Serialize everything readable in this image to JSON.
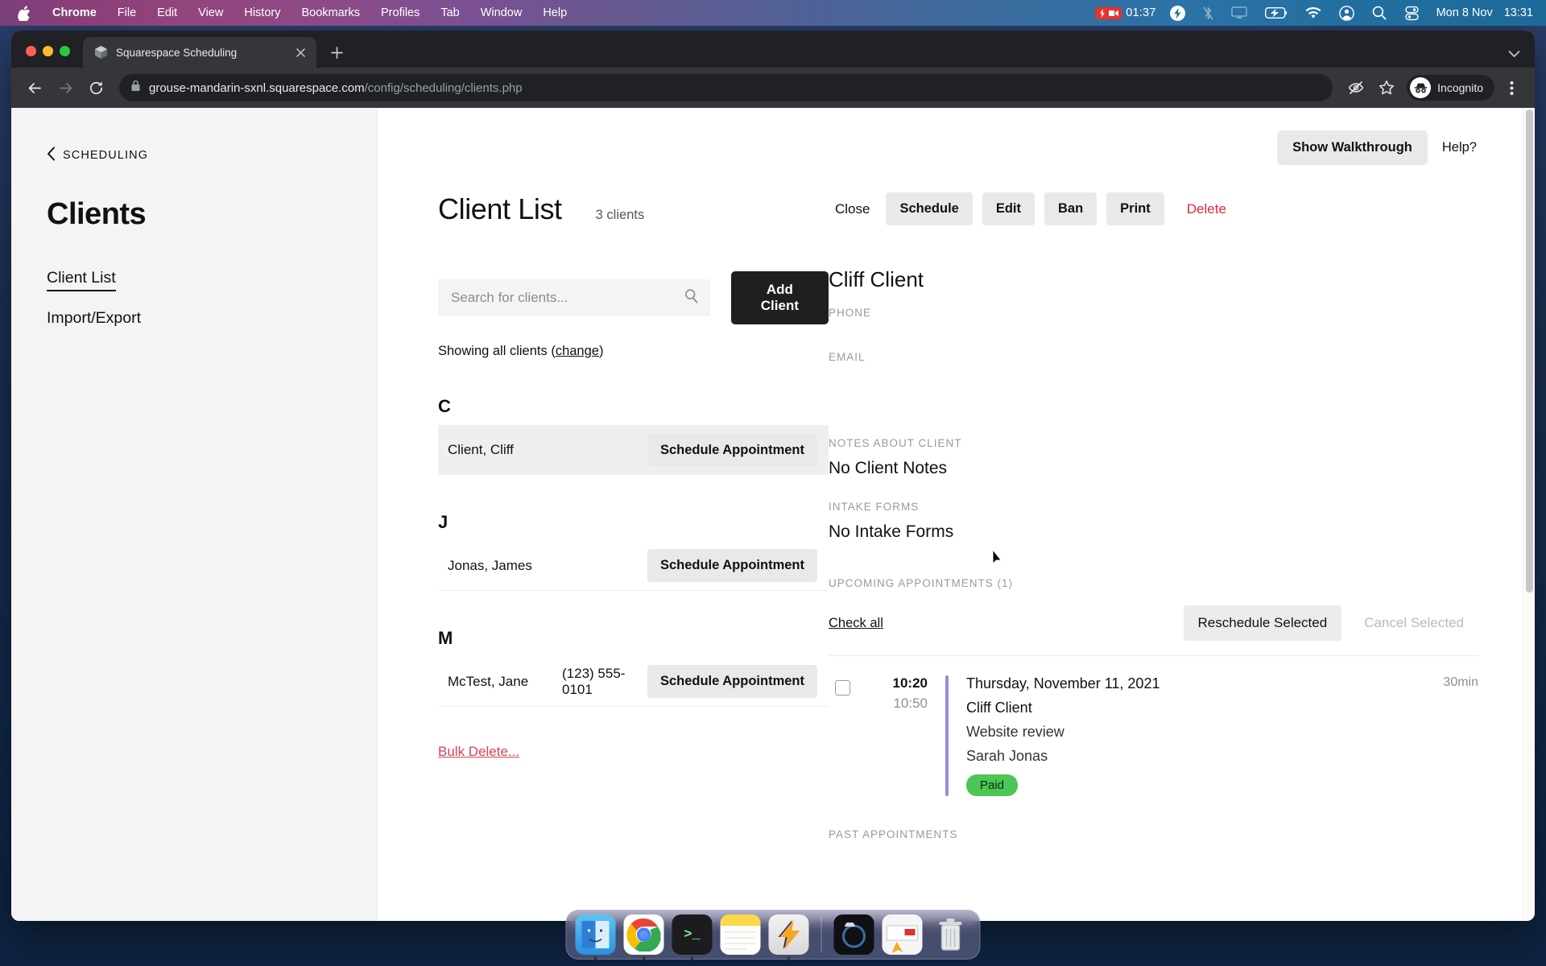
{
  "menubar": {
    "apple_icon": "apple-logo-icon",
    "items": [
      {
        "label": "Chrome",
        "bold": true
      },
      {
        "label": "File",
        "bold": false
      },
      {
        "label": "Edit",
        "bold": false
      },
      {
        "label": "View",
        "bold": false
      },
      {
        "label": "History",
        "bold": false
      },
      {
        "label": "Bookmarks",
        "bold": false
      },
      {
        "label": "Profiles",
        "bold": false
      },
      {
        "label": "Tab",
        "bold": false
      },
      {
        "label": "Window",
        "bold": false
      },
      {
        "label": "Help",
        "bold": false
      }
    ],
    "recording_time": "01:37",
    "status_icons": [
      "screen-record-icon",
      "bolt-icon",
      "bluetooth-off-icon",
      "screen-mirroring-icon",
      "battery-charging-icon",
      "wifi-icon",
      "user-account-icon",
      "search-icon",
      "control-center-icon"
    ],
    "date": "Mon 8 Nov",
    "time": "13:31"
  },
  "browser": {
    "tab": {
      "title": "Squarespace Scheduling",
      "favicon": "cube-favicon",
      "close_icon": "close-icon"
    },
    "new_tab_icon": "plus-icon",
    "tabstrip_chevron_icon": "chevron-down-icon",
    "nav": {
      "back_icon": "back-arrow-icon",
      "forward_icon": "forward-arrow-icon",
      "reload_icon": "reload-icon"
    },
    "omnibox": {
      "lock_icon": "lock-icon",
      "domain": "grouse-mandarin-sxnl.squarespace.com",
      "path": "/config/scheduling/clients.php"
    },
    "toolbar_right": {
      "eye_slash_icon": "eye-slash-icon",
      "bookmark_icon": "star-icon",
      "incognito_label": "Incognito",
      "incognito_icon": "incognito-icon",
      "menu_icon": "three-dot-menu-icon"
    }
  },
  "page": {
    "topbar": {
      "walkthrough_label": "Show Walkthrough",
      "help_label": "Help?"
    },
    "sidebar": {
      "breadcrumb": "SCHEDULING",
      "breadcrumb_icon": "chevron-left-icon",
      "title": "Clients",
      "items": [
        {
          "label": "Client List",
          "active": true
        },
        {
          "label": "Import/Export",
          "active": false
        }
      ]
    },
    "client_list": {
      "title": "Client List",
      "count": "3 clients",
      "search_placeholder": "Search for clients...",
      "search_value": "",
      "search_icon": "search-icon",
      "add_client_label": "Add Client",
      "showing_prefix": "Showing all clients (",
      "showing_link": "change",
      "showing_suffix": ")",
      "schedule_label": "Schedule Appointment",
      "groups": [
        {
          "letter": "C",
          "rows": [
            {
              "name": "Client, Cliff",
              "phone": "",
              "selected": true
            }
          ]
        },
        {
          "letter": "J",
          "rows": [
            {
              "name": "Jonas, James",
              "phone": "",
              "selected": false
            }
          ]
        },
        {
          "letter": "M",
          "rows": [
            {
              "name": "McTest, Jane",
              "phone": "(123) 555-0101",
              "selected": false
            }
          ]
        }
      ],
      "bulk_delete_label": "Bulk Delete..."
    },
    "detail": {
      "actions": {
        "close_label": "Close",
        "schedule_label": "Schedule",
        "edit_label": "Edit",
        "ban_label": "Ban",
        "print_label": "Print",
        "delete_label": "Delete"
      },
      "name": "Cliff Client",
      "phone_label": "PHONE",
      "phone_value": "",
      "email_label": "EMAIL",
      "email_value": "",
      "notes_label": "NOTES ABOUT CLIENT",
      "notes_value": "No Client Notes",
      "intake_label": "INTAKE FORMS",
      "intake_value": "No Intake Forms",
      "upcoming_label": "UPCOMING APPOINTMENTS (1)",
      "check_all_label": "Check all",
      "reschedule_label": "Reschedule Selected",
      "cancel_label": "Cancel Selected",
      "appointments": [
        {
          "start_time": "10:20",
          "end_time": "10:50",
          "date": "Thursday, November 11, 2021",
          "client": "Cliff Client",
          "service": "Website review",
          "staff": "Sarah Jonas",
          "status_badge": "Paid",
          "duration": "30min",
          "checked": false
        }
      ],
      "past_label": "PAST APPOINTMENTS"
    }
  },
  "dock": {
    "items": [
      {
        "name": "finder",
        "glyph": "🙂"
      },
      {
        "name": "chrome",
        "glyph": ""
      },
      {
        "name": "terminal",
        "glyph": ">_"
      },
      {
        "name": "notes",
        "glyph": ""
      },
      {
        "name": "bolt-app",
        "glyph": "⚡"
      }
    ],
    "items_right": [
      {
        "name": "preview-app",
        "glyph": ""
      },
      {
        "name": "mail-app",
        "glyph": ""
      },
      {
        "name": "trash",
        "glyph": "🗑"
      }
    ]
  },
  "colors": {
    "accent_dark": "#1f1f1f",
    "danger": "#e0283e",
    "bulk_delete": "#d94257",
    "paid_green": "#4cc654",
    "appt_bar_purple": "#9b8bd6",
    "sidebar_bg": "#f4f4f4"
  }
}
